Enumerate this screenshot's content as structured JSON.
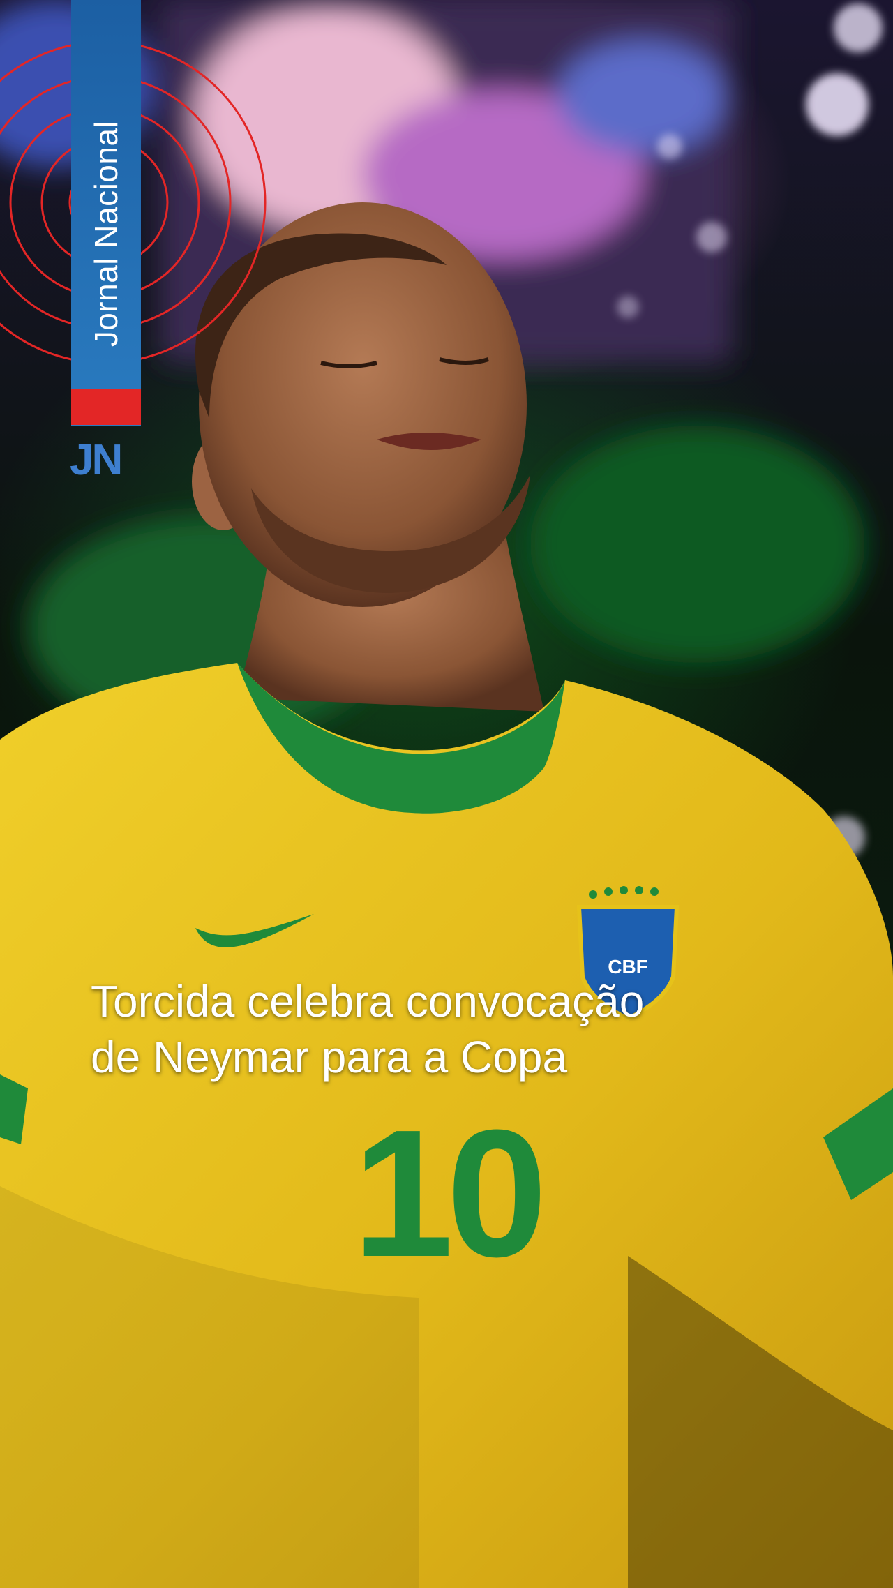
{
  "branding": {
    "program_name": "Jornal Nacional",
    "mark": "JN",
    "colors": {
      "blue": "#2a7bc0",
      "red": "#e32626",
      "mark_blue": "#3e7fd0"
    }
  },
  "headline": {
    "line1": "Torcida celebra convocação",
    "line2": "de Neymar para a Copa"
  },
  "photo": {
    "jersey_number": "10",
    "crest_text": "CBF",
    "colors": {
      "jersey": "#e7c21a",
      "trim": "#1f8a3a"
    }
  }
}
